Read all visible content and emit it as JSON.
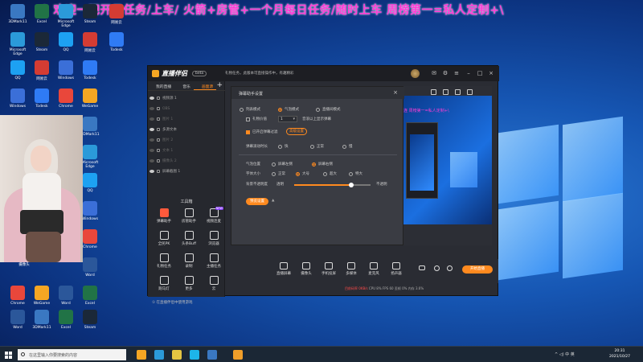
{
  "banner": {
    "text": "！欢迎一吧开日任务/上车/ 火箭+房管+一个月每日任务/随时上车   周榜第一=私人定制+\\"
  },
  "desktop_icons": [
    {
      "label": "3DMark11",
      "color": "#3a78c2"
    },
    {
      "label": "Microsoft Edge",
      "color": "#2b9ad9"
    },
    {
      "label": "QQ",
      "color": "#1da1f2"
    },
    {
      "label": "Windows",
      "color": "#3b6fd8"
    },
    {
      "label": "Chrome",
      "color": "#e9473b"
    },
    {
      "label": "Word",
      "color": "#2b579a"
    },
    {
      "label": "Excel",
      "color": "#217346"
    },
    {
      "label": "Steam",
      "color": "#1b2838"
    },
    {
      "label": "网易云",
      "color": "#d43c33"
    },
    {
      "label": "Todesk",
      "color": "#2f7bf5"
    },
    {
      "label": "WeGame",
      "color": "#f5a623"
    }
  ],
  "webcam": {
    "caption": "摄像头"
  },
  "app": {
    "logo_text": "直播伴侣",
    "version": "beta",
    "notice": "礼物任务，此版本可直接操作中，有趣精彩",
    "tabs": [
      {
        "label": "我的直播"
      },
      {
        "label": "音乐"
      },
      {
        "label": "画面源",
        "active": true
      }
    ],
    "sources": [
      {
        "label": "视频源 1",
        "visible": true
      },
      {
        "label": "OBS",
        "visible": false
      },
      {
        "label": "图片 1",
        "visible": false
      },
      {
        "label": "多源文本",
        "visible": true
      },
      {
        "label": "图片 2",
        "visible": false
      },
      {
        "label": "文本 1",
        "visible": false
      },
      {
        "label": "摄像头 2",
        "visible": false
      },
      {
        "label": "屏幕截图 1",
        "visible": true
      }
    ],
    "tools_title": "工具箱",
    "tools": [
      {
        "label": "弹幕助手",
        "highlight": true
      },
      {
        "label": "房管助手"
      },
      {
        "label": "视频连麦",
        "badge": "NEW"
      },
      {
        "label": "全民PK"
      },
      {
        "label": "头条Buff"
      },
      {
        "label": "浏览器"
      },
      {
        "label": "礼物任务"
      },
      {
        "label": "录制"
      },
      {
        "label": "主播任务"
      },
      {
        "label": "跑马灯"
      },
      {
        "label": "更多"
      },
      {
        "label": "云"
      }
    ],
    "hint": "① 在直播伴侣中使用游戏"
  },
  "dialog": {
    "title": "弹幕助手设置",
    "close": "×",
    "mode_options": [
      "列表模式",
      "气泡模式",
      "直播间模式"
    ],
    "mode_selected": 1,
    "gift_value_label": "礼物价值",
    "gift_value": "1",
    "gift_value_suffix": "音浪以上显示弹幕",
    "enable_filter_label": "已开启弹幕过滤",
    "filter_button": "高级设置",
    "speed_label": "弹幕滚动时长",
    "speed_options": [
      "快",
      "正常",
      "慢"
    ],
    "position_label": "气泡位置",
    "position_options": [
      "屏幕左侧",
      "屏幕右侧"
    ],
    "position_selected": 1,
    "font_label": "字体大小",
    "font_options": [
      "正常",
      "大号",
      "超大",
      "特大"
    ],
    "font_selected": 1,
    "opacity_label": "背景不透明度",
    "opacity_left": "透明",
    "opacity_right": "不透明",
    "opacity_value": 0.75,
    "bottom_button": "预览设置",
    "expand_label": "▲"
  },
  "preview": {
    "pink_text": "连    周榜第一=私人定制+\\"
  },
  "bottombar": {
    "items": [
      {
        "label": "直播屏幕"
      },
      {
        "label": "摄像头"
      },
      {
        "label": "手机投屏"
      },
      {
        "label": "多媒体"
      },
      {
        "label": "麦克风"
      },
      {
        "label": "扬声器"
      }
    ],
    "start_live": "开始直播",
    "status_red": "目前码率 0KB/s",
    "status": "CPU 8%   FPS 60   丢帧 0%   内存 3.6%"
  },
  "taskbar": {
    "search_placeholder": "在这里输入你要搜索的内容",
    "tray": "^  ◁)  中  英",
    "time": "20:31",
    "date": "2021/10/27",
    "apps": [
      {
        "color": "#f5a623"
      },
      {
        "color": "#2b9ad9"
      },
      {
        "color": "#e4c542"
      },
      {
        "color": "#1db5e9"
      },
      {
        "color": "#3a78c2"
      },
      {
        "color": "#f09e2a"
      }
    ]
  }
}
